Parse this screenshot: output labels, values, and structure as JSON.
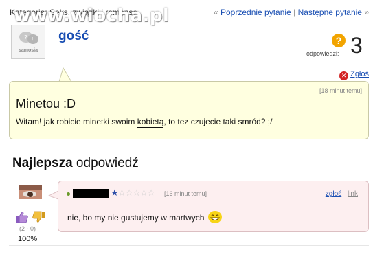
{
  "header": {
    "category_prefix": "Kategoria:",
    "category_link": "Seks, związki i romanse",
    "watermark": "www.wiocha.pl",
    "nav": {
      "prev_prefix": "«",
      "prev_label": "Poprzednie pytanie",
      "separator": "|",
      "next_label": "Następne pytanie",
      "next_suffix": "»"
    }
  },
  "question": {
    "avatar_brand": "samosia",
    "author": "gość",
    "answers_label": "odpowiedzi:",
    "answers_count": "3",
    "question_icon": "question-mark-icon",
    "report_label": "Zgłoś",
    "report_icon": "close-icon",
    "time": "[18 minut temu]",
    "title": "Minetou :D",
    "body_before": "Witam! jak robicie minetki swoim ",
    "body_emph": "kobietą",
    "body_after": ", to tez czujecie taki smród? ;/"
  },
  "best_answer": {
    "heading_bold": "Najlepsza",
    "heading_rest": " odpowiedź",
    "rating_stars_filled": 1,
    "rating_stars_total": 6,
    "time": "[16 minut temu]",
    "report_label": "zgłoś",
    "link_label": "link",
    "body": "nie, bo my nie gustujemy w martwych",
    "votes": "(2 - 0)",
    "percent": "100%"
  },
  "colors": {
    "link": "#1a4fb3",
    "question_bg": "#ffffe0",
    "answer_bg": "#fdeff0",
    "star_filled": "#2d4fa8",
    "report_red": "#d32424",
    "answers_badge": "#f2a400"
  }
}
